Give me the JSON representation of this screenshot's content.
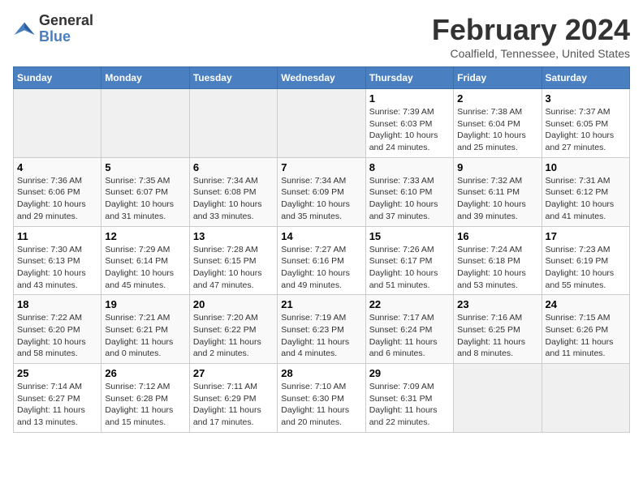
{
  "logo": {
    "general": "General",
    "blue": "Blue"
  },
  "title": "February 2024",
  "subtitle": "Coalfield, Tennessee, United States",
  "days_of_week": [
    "Sunday",
    "Monday",
    "Tuesday",
    "Wednesday",
    "Thursday",
    "Friday",
    "Saturday"
  ],
  "weeks": [
    [
      {
        "day": "",
        "info": ""
      },
      {
        "day": "",
        "info": ""
      },
      {
        "day": "",
        "info": ""
      },
      {
        "day": "",
        "info": ""
      },
      {
        "day": "1",
        "info": "Sunrise: 7:39 AM\nSunset: 6:03 PM\nDaylight: 10 hours and 24 minutes."
      },
      {
        "day": "2",
        "info": "Sunrise: 7:38 AM\nSunset: 6:04 PM\nDaylight: 10 hours and 25 minutes."
      },
      {
        "day": "3",
        "info": "Sunrise: 7:37 AM\nSunset: 6:05 PM\nDaylight: 10 hours and 27 minutes."
      }
    ],
    [
      {
        "day": "4",
        "info": "Sunrise: 7:36 AM\nSunset: 6:06 PM\nDaylight: 10 hours and 29 minutes."
      },
      {
        "day": "5",
        "info": "Sunrise: 7:35 AM\nSunset: 6:07 PM\nDaylight: 10 hours and 31 minutes."
      },
      {
        "day": "6",
        "info": "Sunrise: 7:34 AM\nSunset: 6:08 PM\nDaylight: 10 hours and 33 minutes."
      },
      {
        "day": "7",
        "info": "Sunrise: 7:34 AM\nSunset: 6:09 PM\nDaylight: 10 hours and 35 minutes."
      },
      {
        "day": "8",
        "info": "Sunrise: 7:33 AM\nSunset: 6:10 PM\nDaylight: 10 hours and 37 minutes."
      },
      {
        "day": "9",
        "info": "Sunrise: 7:32 AM\nSunset: 6:11 PM\nDaylight: 10 hours and 39 minutes."
      },
      {
        "day": "10",
        "info": "Sunrise: 7:31 AM\nSunset: 6:12 PM\nDaylight: 10 hours and 41 minutes."
      }
    ],
    [
      {
        "day": "11",
        "info": "Sunrise: 7:30 AM\nSunset: 6:13 PM\nDaylight: 10 hours and 43 minutes."
      },
      {
        "day": "12",
        "info": "Sunrise: 7:29 AM\nSunset: 6:14 PM\nDaylight: 10 hours and 45 minutes."
      },
      {
        "day": "13",
        "info": "Sunrise: 7:28 AM\nSunset: 6:15 PM\nDaylight: 10 hours and 47 minutes."
      },
      {
        "day": "14",
        "info": "Sunrise: 7:27 AM\nSunset: 6:16 PM\nDaylight: 10 hours and 49 minutes."
      },
      {
        "day": "15",
        "info": "Sunrise: 7:26 AM\nSunset: 6:17 PM\nDaylight: 10 hours and 51 minutes."
      },
      {
        "day": "16",
        "info": "Sunrise: 7:24 AM\nSunset: 6:18 PM\nDaylight: 10 hours and 53 minutes."
      },
      {
        "day": "17",
        "info": "Sunrise: 7:23 AM\nSunset: 6:19 PM\nDaylight: 10 hours and 55 minutes."
      }
    ],
    [
      {
        "day": "18",
        "info": "Sunrise: 7:22 AM\nSunset: 6:20 PM\nDaylight: 10 hours and 58 minutes."
      },
      {
        "day": "19",
        "info": "Sunrise: 7:21 AM\nSunset: 6:21 PM\nDaylight: 11 hours and 0 minutes."
      },
      {
        "day": "20",
        "info": "Sunrise: 7:20 AM\nSunset: 6:22 PM\nDaylight: 11 hours and 2 minutes."
      },
      {
        "day": "21",
        "info": "Sunrise: 7:19 AM\nSunset: 6:23 PM\nDaylight: 11 hours and 4 minutes."
      },
      {
        "day": "22",
        "info": "Sunrise: 7:17 AM\nSunset: 6:24 PM\nDaylight: 11 hours and 6 minutes."
      },
      {
        "day": "23",
        "info": "Sunrise: 7:16 AM\nSunset: 6:25 PM\nDaylight: 11 hours and 8 minutes."
      },
      {
        "day": "24",
        "info": "Sunrise: 7:15 AM\nSunset: 6:26 PM\nDaylight: 11 hours and 11 minutes."
      }
    ],
    [
      {
        "day": "25",
        "info": "Sunrise: 7:14 AM\nSunset: 6:27 PM\nDaylight: 11 hours and 13 minutes."
      },
      {
        "day": "26",
        "info": "Sunrise: 7:12 AM\nSunset: 6:28 PM\nDaylight: 11 hours and 15 minutes."
      },
      {
        "day": "27",
        "info": "Sunrise: 7:11 AM\nSunset: 6:29 PM\nDaylight: 11 hours and 17 minutes."
      },
      {
        "day": "28",
        "info": "Sunrise: 7:10 AM\nSunset: 6:30 PM\nDaylight: 11 hours and 20 minutes."
      },
      {
        "day": "29",
        "info": "Sunrise: 7:09 AM\nSunset: 6:31 PM\nDaylight: 11 hours and 22 minutes."
      },
      {
        "day": "",
        "info": ""
      },
      {
        "day": "",
        "info": ""
      }
    ]
  ]
}
